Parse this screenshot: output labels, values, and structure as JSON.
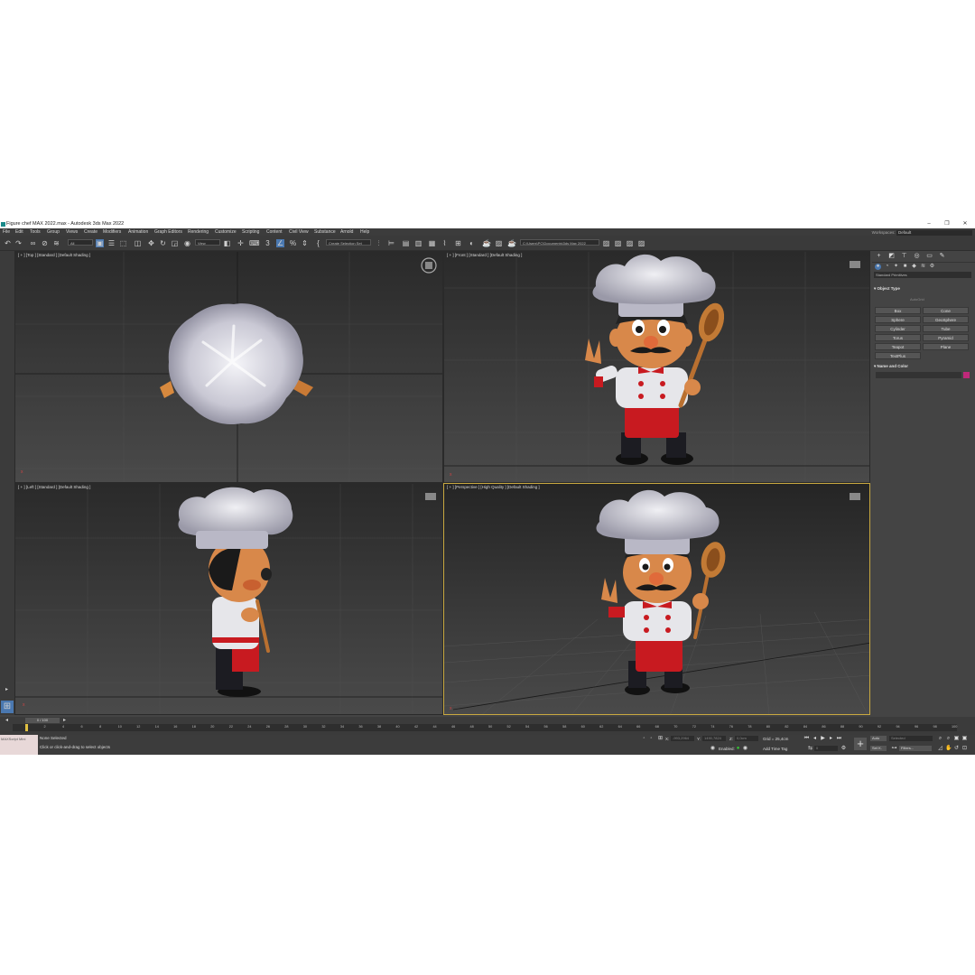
{
  "window": {
    "title": "Figure chef MAX 2022.max - Autodesk 3ds Max 2022",
    "minimize": "–",
    "restore": "❐",
    "close": "✕"
  },
  "menu": [
    "File",
    "Edit",
    "Tools",
    "Group",
    "Views",
    "Create",
    "Modifiers",
    "Animation",
    "Graph Editors",
    "Rendering",
    "Customize",
    "Scripting",
    "Content",
    "Civil View",
    "Substance",
    "Arnold",
    "Help"
  ],
  "workspace": {
    "label": "Workspaces:",
    "value": "Default"
  },
  "toolbar": {
    "filter_value": "All",
    "view_value": "View",
    "selection_set": "Create Selection Set",
    "project_path": "C:\\Users\\PC\\Documents\\3ds Max 2022",
    "snap_value": "3",
    "percent_icon": "%"
  },
  "viewports": {
    "top": "[ + ] [Top ] [Standard ] [Default Shading ]",
    "front": "[ + ] [Front ] [Standard ] [Default Shading ]",
    "left": "[ + ] [Left ] [Standard ] [Default Shading ]",
    "perspective": "[ + ] [Perspective ] [High Quality ] [Default Shading ]"
  },
  "command_panel": {
    "category": "Standard Primitives",
    "object_type": "Object Type",
    "autogrid": "AutoGrid",
    "primitives": [
      "Box",
      "Cone",
      "Sphere",
      "GeoSphere",
      "Cylinder",
      "Tube",
      "Torus",
      "Pyramid",
      "Teapot",
      "Plane",
      "TextPlus"
    ],
    "name_and_color": "Name and Color",
    "color": "#c0287a"
  },
  "timeline": {
    "frame": "0 / 100",
    "ticks": [
      "0",
      "2",
      "4",
      "6",
      "8",
      "10",
      "12",
      "14",
      "16",
      "18",
      "20",
      "22",
      "24",
      "26",
      "28",
      "30",
      "32",
      "34",
      "36",
      "38",
      "40",
      "42",
      "44",
      "46",
      "48",
      "50",
      "52",
      "54",
      "56",
      "58",
      "60",
      "62",
      "64",
      "66",
      "68",
      "70",
      "72",
      "74",
      "76",
      "78",
      "80",
      "82",
      "84",
      "86",
      "88",
      "90",
      "92",
      "94",
      "96",
      "98",
      "100"
    ]
  },
  "status": {
    "maxscript": "MAXScript Mini",
    "selection": "None Selected",
    "prompt": "Click or click-and-drag to select objects",
    "x_label": "X:",
    "y_label": "Y:",
    "z_label": "Z:",
    "x_value": "-993,2964",
    "y_value": "1490,7824",
    "z_value": "0,0cm",
    "grid": "Grid = 25,4cm",
    "enabled": "Enabled:",
    "add_time_tag": "Add Time Tag",
    "auto": "Auto",
    "set_k": "Set K.",
    "selected_value": "Selected",
    "filters": "Filters...",
    "frame_field": "0"
  }
}
